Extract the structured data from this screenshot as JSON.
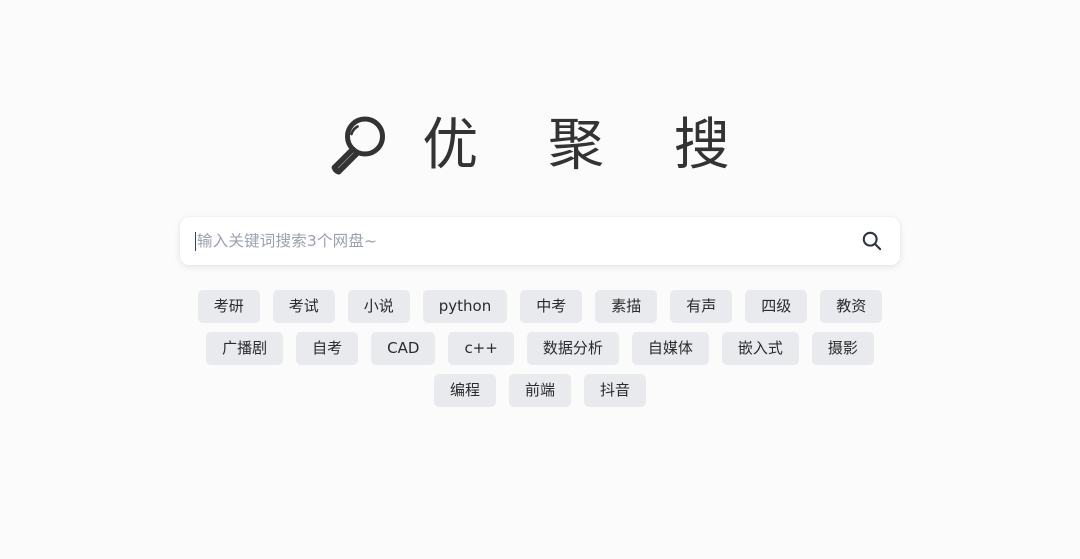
{
  "brand": {
    "logo_icon": "magnifier-icon",
    "title": "优 聚 搜"
  },
  "search": {
    "placeholder": "输入关键词搜索3个网盘~",
    "value": "",
    "button_icon": "search-icon",
    "caret_visible": true
  },
  "hot_tags": {
    "rows": [
      [
        "考研",
        "考试",
        "小说",
        "python",
        "中考",
        "素描",
        "有声",
        "四级",
        "教资"
      ],
      [
        "广播剧",
        "自考",
        "CAD",
        "c++",
        "数据分析",
        "自媒体",
        "嵌入式",
        "摄影"
      ],
      [
        "编程",
        "前端",
        "抖音"
      ]
    ]
  },
  "colors": {
    "page_background": "#fbfbfb",
    "title_text": "#333333",
    "search_background": "#ffffff",
    "placeholder_text": "#9ba1b0",
    "search_icon": "#2e3440",
    "tag_background": "#e9eaee",
    "tag_text": "#2b2b2b"
  }
}
